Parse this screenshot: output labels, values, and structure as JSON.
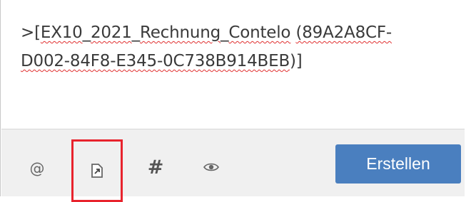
{
  "editor": {
    "prefix": ">[",
    "word_ex": "EX10",
    "sep1": "_",
    "word_year": "2021",
    "sep2": "_",
    "word_rechnung": "Rechnung",
    "sep3": "_",
    "word_contelo": "Contelo",
    "gap": " ",
    "word_id_open": "(89A2A8CF-",
    "word_id_rest": "D002-84F8-E345-0C738B914BEB",
    "suffix": ")]"
  },
  "toolbar": {
    "mention_symbol": "@",
    "link_icon": "link-document-icon",
    "tag_symbol": "#",
    "eye_icon": "eye-icon",
    "create_label": "Erstellen",
    "accent_color": "#4a7fbf",
    "highlight_color": "#e8232d"
  }
}
